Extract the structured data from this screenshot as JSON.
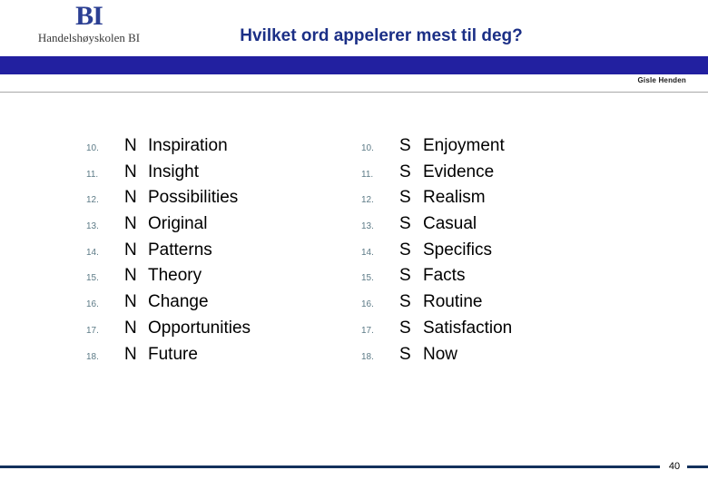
{
  "slide": {
    "title": "Hvilket ord appelerer mest til deg?",
    "author": "Gisle Henden",
    "page_number": "40",
    "logo": {
      "mark": "BI",
      "wordmark": "Handelshøyskolen BI"
    },
    "colors": {
      "header_bar": "#2220a0",
      "title_text": "#1b2f86",
      "logo_mark": "#2b3f93",
      "footer_rule": "#13315c",
      "row_number": "#5c7a86",
      "row_text": "#000000",
      "header_rule": "#a8a8a8"
    }
  },
  "columns": {
    "left": [
      {
        "number": "10.",
        "letter": "N",
        "word": "Inspiration"
      },
      {
        "number": "11.",
        "letter": "N",
        "word": "Insight"
      },
      {
        "number": "12.",
        "letter": "N",
        "word": "Possibilities"
      },
      {
        "number": "13.",
        "letter": "N",
        "word": "Original"
      },
      {
        "number": "14.",
        "letter": "N",
        "word": "Patterns"
      },
      {
        "number": "15.",
        "letter": "N",
        "word": "Theory"
      },
      {
        "number": "16.",
        "letter": "N",
        "word": "Change"
      },
      {
        "number": "17.",
        "letter": "N",
        "word": "Opportunities"
      },
      {
        "number": "18.",
        "letter": "N",
        "word": "Future"
      }
    ],
    "right": [
      {
        "number": "10.",
        "letter": "S",
        "word": "Enjoyment"
      },
      {
        "number": "11.",
        "letter": "S",
        "word": "Evidence"
      },
      {
        "number": "12.",
        "letter": "S",
        "word": "Realism"
      },
      {
        "number": "13.",
        "letter": "S",
        "word": "Casual"
      },
      {
        "number": "14.",
        "letter": "S",
        "word": "Specifics"
      },
      {
        "number": "15.",
        "letter": "S",
        "word": "Facts"
      },
      {
        "number": "16.",
        "letter": "S",
        "word": "Routine"
      },
      {
        "number": "17.",
        "letter": "S",
        "word": "Satisfaction"
      },
      {
        "number": "18.",
        "letter": "S",
        "word": "Now"
      }
    ]
  }
}
